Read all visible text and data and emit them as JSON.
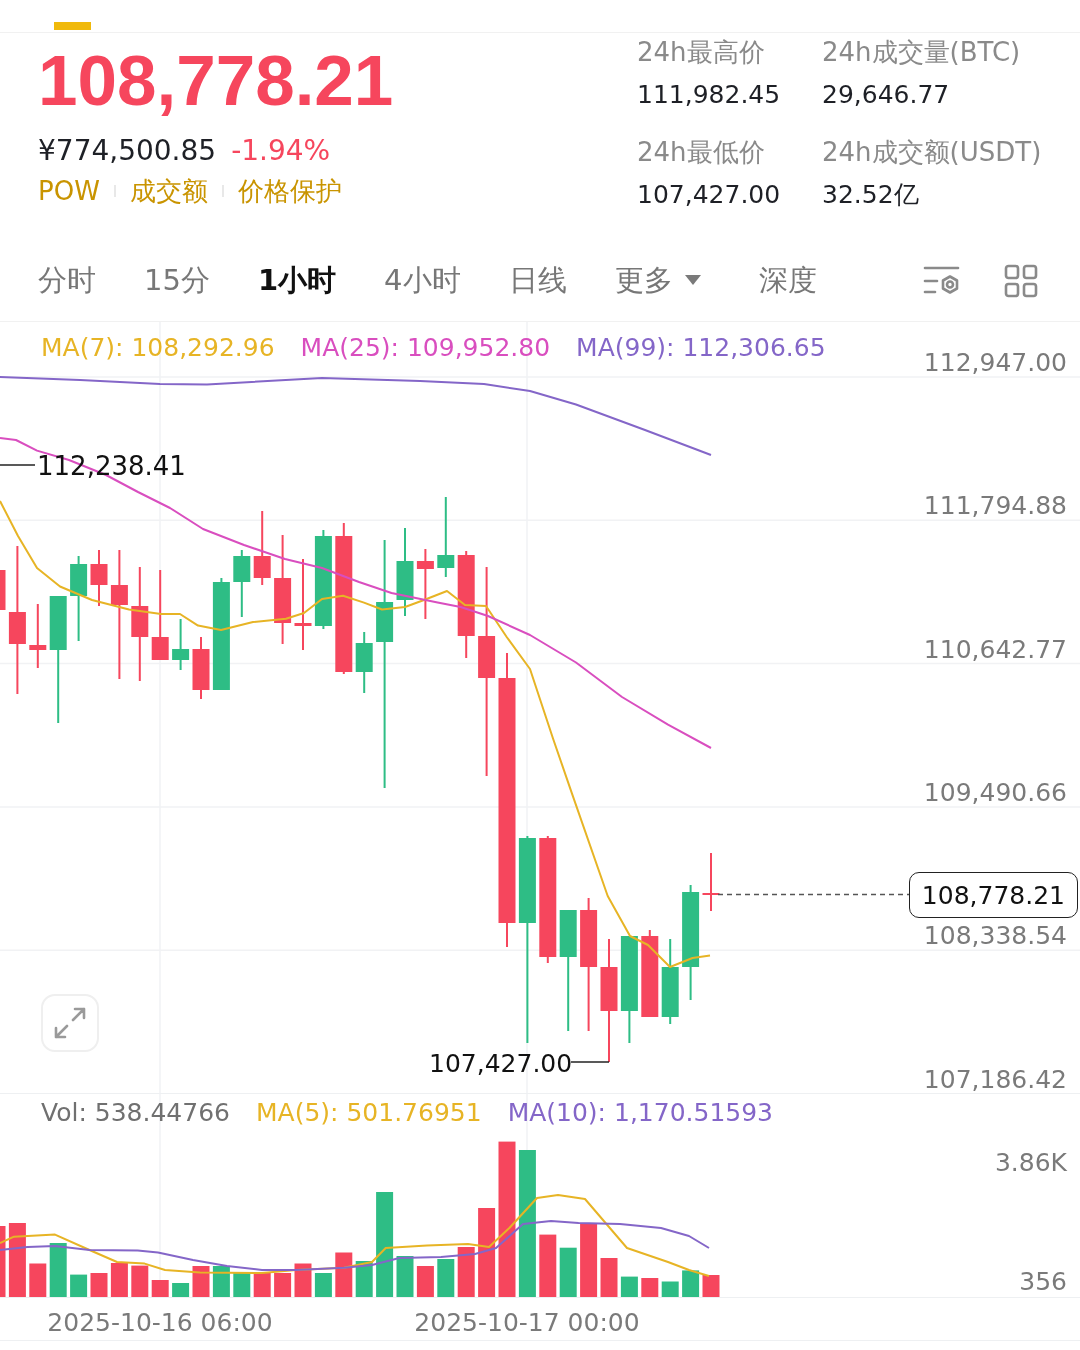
{
  "header": {
    "price": "108,778.21",
    "fiat_price": "¥774,500.85",
    "change": "-1.94%",
    "tags": [
      "POW",
      "成交额",
      "价格保护"
    ]
  },
  "stats": [
    {
      "label": "24h最高价",
      "value": "111,982.45"
    },
    {
      "label": "24h成交量(BTC)",
      "value": "29,646.77"
    },
    {
      "label": "24h最低价",
      "value": "107,427.00"
    },
    {
      "label": "24h成交额(USDT)",
      "value": "32.52亿"
    }
  ],
  "intervals": [
    {
      "label": "分时",
      "kind": "tab",
      "selected": false
    },
    {
      "label": "15分",
      "kind": "tab",
      "selected": false
    },
    {
      "label": "1小时",
      "kind": "tab",
      "selected": true
    },
    {
      "label": "4小时",
      "kind": "tab",
      "selected": false
    },
    {
      "label": "日线",
      "kind": "tab",
      "selected": false
    },
    {
      "label": "更多",
      "kind": "dropdown",
      "selected": false
    },
    {
      "label": "深度",
      "kind": "tab",
      "selected": false
    }
  ],
  "chart": {
    "ma_legend": [
      {
        "label": "MA(7): 108,292.96",
        "color": "#e7b425"
      },
      {
        "label": "MA(25): 109,952.80",
        "color": "#d94ebf"
      },
      {
        "label": "MA(99): 112,306.65",
        "color": "#8466c8"
      }
    ],
    "price_axis": [
      "112,947.00",
      "111,794.88",
      "110,642.77",
      "109,490.66",
      "108,338.54",
      "107,186.42"
    ],
    "high_label": "112,238.41",
    "low_label": "107,427.00",
    "last_price": "108,778.21"
  },
  "volume": {
    "legend": [
      {
        "label": "Vol: 538.44766",
        "color": "#707070"
      },
      {
        "label": "MA(5): 501.76951",
        "color": "#e7b425"
      },
      {
        "label": "MA(10): 1,170.51593",
        "color": "#8466c8"
      }
    ],
    "axis": [
      "3.86K",
      "356"
    ]
  },
  "time_axis": [
    "2025-10-16 06:00",
    "2025-10-17 00:00"
  ]
}
